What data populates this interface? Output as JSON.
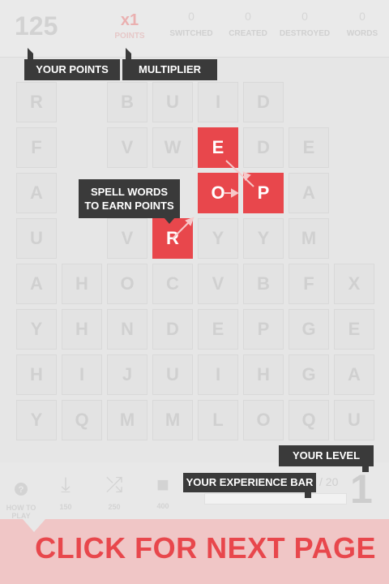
{
  "header": {
    "score": "125",
    "multiplier_value": "x1",
    "multiplier_label": "POINTS",
    "stats": [
      {
        "value": "0",
        "label": "SWITCHED"
      },
      {
        "value": "0",
        "label": "CREATED"
      },
      {
        "value": "0",
        "label": "DESTROYED"
      },
      {
        "value": "0",
        "label": "WORDS"
      }
    ]
  },
  "tips": {
    "your_points": "YOUR POINTS",
    "multiplier": "MULTIPLIER",
    "spell_words_line1": "SPELL WORDS",
    "spell_words_line2": "TO EARN POINTS",
    "your_level": "YOUR LEVEL",
    "experience_bar": "YOUR EXPERIENCE BAR"
  },
  "board": {
    "rows": [
      [
        "R",
        "",
        "B",
        "U",
        "I",
        "D",
        "",
        ""
      ],
      [
        "F",
        "",
        "V",
        "W",
        "E",
        "D",
        "E",
        ""
      ],
      [
        "A",
        "",
        "",
        "",
        "O",
        "P",
        "A",
        ""
      ],
      [
        "U",
        "",
        "V",
        "R",
        "Y",
        "Y",
        "M",
        ""
      ],
      [
        "A",
        "H",
        "O",
        "C",
        "V",
        "B",
        "F",
        "X"
      ],
      [
        "Y",
        "H",
        "N",
        "D",
        "E",
        "P",
        "G",
        "E"
      ],
      [
        "H",
        "I",
        "J",
        "U",
        "I",
        "H",
        "G",
        "A"
      ],
      [
        "Y",
        "Q",
        "M",
        "M",
        "L",
        "O",
        "Q",
        "U"
      ]
    ],
    "selected_word": "ROPE"
  },
  "toolbar": {
    "how_to_play_line1": "HOW TO",
    "how_to_play_line2": "PLAY",
    "tools": [
      {
        "icon": "download-icon",
        "glyph": "⤓",
        "label": "150"
      },
      {
        "icon": "shuffle-icon",
        "glyph": "⤮",
        "label": "250"
      },
      {
        "icon": "square-icon",
        "glyph": "■",
        "label": "400"
      }
    ]
  },
  "level": {
    "current": "1",
    "xp_max": "/ 20",
    "xp_fraction": 0.0
  },
  "banner": {
    "text": "CLICK FOR NEXT PAGE"
  },
  "colors": {
    "accent": "#e8474c",
    "tooltip": "#3a3a3a",
    "banner_bg": "#f0c6c6"
  }
}
